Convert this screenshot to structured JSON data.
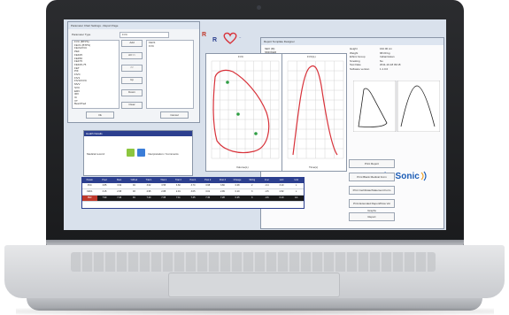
{
  "dialog": {
    "title": "Parameter Chart Settings - Report Page",
    "param_type_label": "Parameter Type",
    "param_type_value": "FVC",
    "params_list": [
      "FVC (BTPS)",
      "FEV1 (BTPS)",
      "FEV1/FVC",
      "PEF",
      "FEF25",
      "FEF50",
      "FEF75",
      "FEF25-75",
      "FET",
      "PIF",
      "FIVC",
      "FIV1",
      "FIV1/FIVC",
      "MVV",
      "SVC",
      "ERV",
      "IRV",
      "IC",
      "VT",
      "Best/Pred"
    ],
    "selected_list": [
      "FEV1",
      "FVC"
    ],
    "buttons": [
      "Add",
      "All >>",
      "<<",
      "Up",
      "Down",
      "Clear"
    ],
    "ok_label": "Ok",
    "cancel_label": "Cancel"
  },
  "toolbar": {
    "r1": "R",
    "r2": "R"
  },
  "report": {
    "title": "Report Template Designer",
    "info_labels": [
      "Height",
      "Weight",
      "Ethnic Group",
      "Smoking",
      "Test Date",
      "Software version"
    ],
    "info_values": [
      "162.00 cm",
      "68.00 kg",
      "Indian/Asian",
      "No",
      "2011-10-18 09:18",
      "1.1.0.0"
    ],
    "left_labels": [
      "SEX (M)",
      "SMOKER",
      "BMI/BSA (Kg/m²)"
    ],
    "fv_title": "FVC",
    "vt_title": "FVC(L)",
    "vt_ylabel": "Volume(L)",
    "vt_xlabel": "Time(s)",
    "fv_xlabel": "Volume(L)"
  },
  "patient": {
    "header": "Health Details",
    "med_label": "Medical record:",
    "comment_label": "Interpretation / Comments"
  },
  "side_buttons": [
    "Print Report",
    "Print Blank Medical Form",
    "Print Certificate/Statement Form",
    "Print Extended Report/Flow Vol Graphs",
    "Report"
  ],
  "brand": {
    "name": "SpiroSonic",
    "color": "#1a5bb5"
  },
  "results": {
    "headers": [
      "Param",
      "Pred",
      "Best",
      "%Pred",
      "Trial 1",
      "Trial 2",
      "Trial 3",
      "Post 1",
      "Post 2",
      "Post 3",
      "Change",
      "%Chg",
      "Z-sc",
      "LLN",
      "Unit"
    ],
    "rows": [
      [
        "FVC",
        "3.85",
        "3.62",
        "94",
        "3.62",
        "3.55",
        "3.60",
        "3.70",
        "3.68",
        "3.66",
        "0.08",
        "2",
        "-0.4",
        "3.10",
        "L"
      ],
      [
        "FEV1",
        "3.15",
        "2.95",
        "93",
        "2.95",
        "2.88",
        "2.91",
        "3.05",
        "3.01",
        "2.99",
        "0.10",
        "3",
        "-0.5",
        "2.52",
        "L"
      ],
      [
        "PEF",
        "7.90",
        "7.20",
        "91",
        "7.20",
        "7.05",
        "7.11",
        "7.45",
        "7.30",
        "7.28",
        "0.25",
        "3",
        "-0.6",
        "6.10",
        "L/s"
      ]
    ]
  },
  "colors": {
    "curve": "#d8323a",
    "point": "#2f9e44",
    "header_bg": "#2c3f8f"
  }
}
